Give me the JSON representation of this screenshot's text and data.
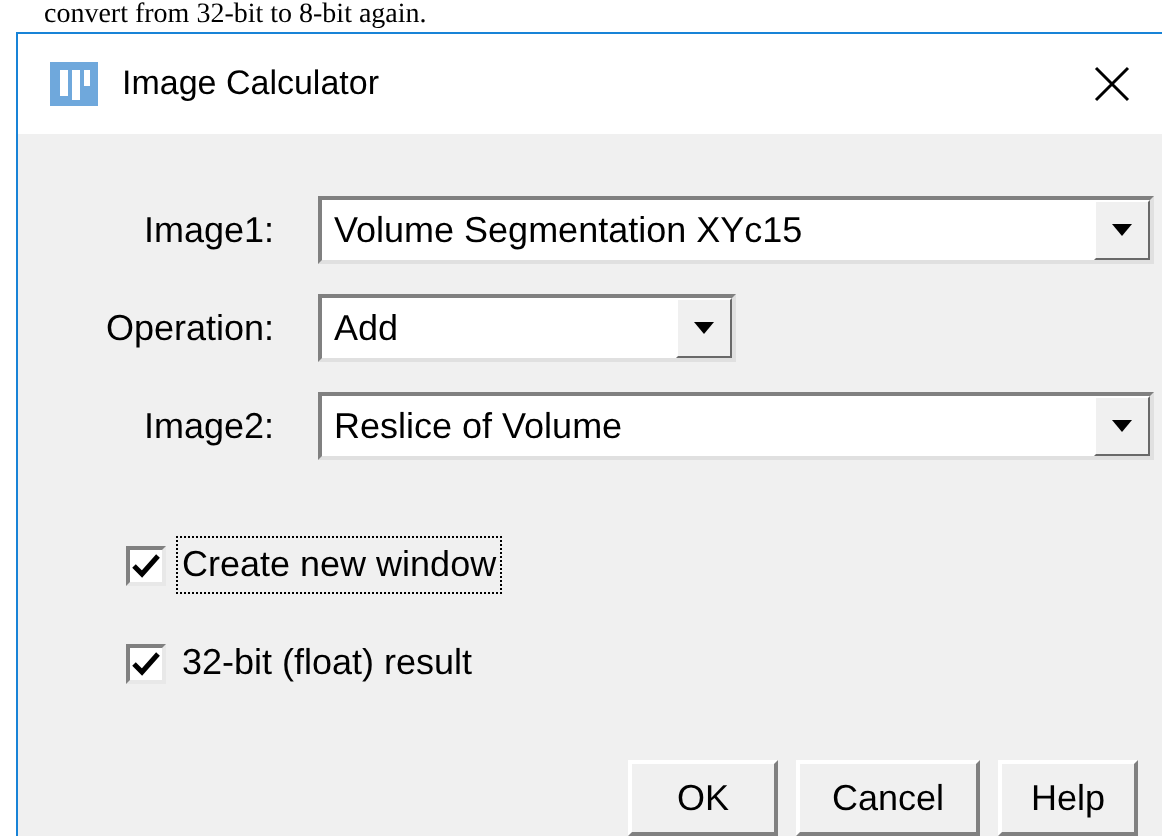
{
  "document_text": "convert from 32-bit to 8-bit again.",
  "window": {
    "title": "Image Calculator"
  },
  "fields": [
    {
      "label": "Image1:",
      "value": "Volume Segmentation XYc15"
    },
    {
      "label": "Operation:",
      "value": "Add"
    },
    {
      "label": "Image2:",
      "value": "Reslice of Volume"
    }
  ],
  "checkboxes": [
    {
      "label": "Create new window",
      "checked": true,
      "focused": true
    },
    {
      "label": "32-bit (float) result",
      "checked": true,
      "focused": false
    }
  ],
  "buttons": [
    "OK",
    "Cancel",
    "Help"
  ]
}
